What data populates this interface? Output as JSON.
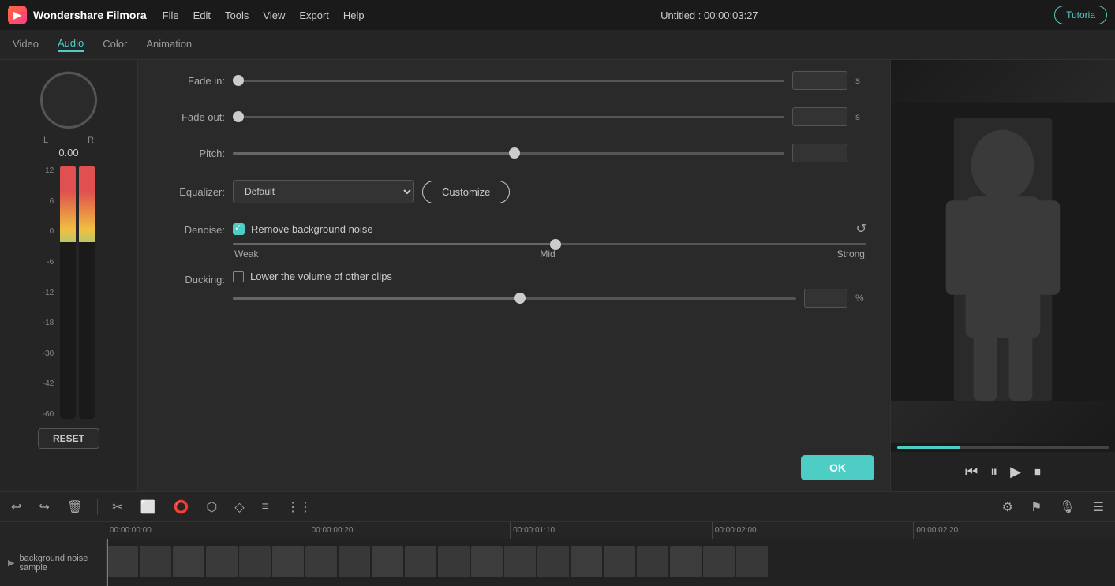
{
  "app": {
    "name": "Wondershare Filmora",
    "title": "Untitled : 00:00:03:27",
    "tutorial_label": "Tutoria"
  },
  "menu": {
    "items": [
      "File",
      "Edit",
      "Tools",
      "View",
      "Export",
      "Help"
    ]
  },
  "tabs": {
    "items": [
      "Video",
      "Audio",
      "Color",
      "Animation"
    ],
    "active": "Audio"
  },
  "audio_panel": {
    "fade_in_label": "Fade in:",
    "fade_in_value": "0.00",
    "fade_in_unit": "s",
    "fade_out_label": "Fade out:",
    "fade_out_value": "0.00",
    "fade_out_unit": "s",
    "pitch_label": "Pitch:",
    "pitch_value": "0",
    "equalizer_label": "Equalizer:",
    "equalizer_default": "Default",
    "customize_label": "Customize",
    "denoise_label": "Denoise:",
    "denoise_checkbox_label": "Remove background noise",
    "denoise_weak": "Weak",
    "denoise_mid": "Mid",
    "denoise_strong": "Strong",
    "ducking_label": "Ducking:",
    "ducking_checkbox_label": "Lower the volume of other clips",
    "ducking_value": "50",
    "ducking_unit": "%"
  },
  "meter": {
    "lr_l": "L",
    "lr_r": "R",
    "volume": "0.00",
    "scale": [
      "12",
      "6",
      "0",
      "-6",
      "-12",
      "-18",
      "-30",
      "-42",
      "-60"
    ],
    "reset_label": "RESET"
  },
  "actions": {
    "ok_label": "OK"
  },
  "playback": {
    "controls": [
      "⏮",
      "⏸",
      "▶",
      "⏹"
    ]
  },
  "timeline": {
    "tools": [
      "↩",
      "↪",
      "🗑",
      "✂",
      "⬜",
      "⭕",
      "⬡",
      "◇",
      "≡",
      "⋮"
    ],
    "ruler_marks": [
      "00:00:00:00",
      "00:00:00:20",
      "00:00:01:10",
      "00:00:02:00",
      "00:00:02:20"
    ],
    "track_label": "background noise sample"
  },
  "cursor_pos": "0%"
}
